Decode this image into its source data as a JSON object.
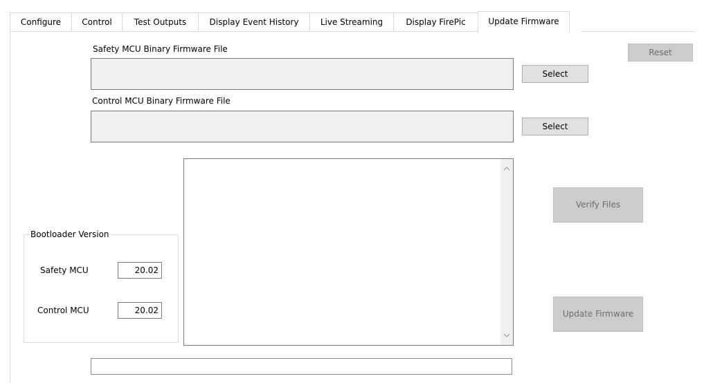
{
  "tabs": [
    {
      "label": "Configure"
    },
    {
      "label": "Control"
    },
    {
      "label": "Test Outputs"
    },
    {
      "label": "Display Event History"
    },
    {
      "label": "Live Streaming"
    },
    {
      "label": "Display FirePic"
    },
    {
      "label": "Update Firmware",
      "active": true
    }
  ],
  "reset_label": "Reset",
  "safety_file": {
    "label": "Safety MCU Binary Firmware File",
    "value": "",
    "select_label": "Select"
  },
  "control_file": {
    "label": "Control MCU Binary Firmware File",
    "value": "",
    "select_label": "Select"
  },
  "log_text": "",
  "verify_label": "Verify Files",
  "update_label": "Update Firmware",
  "bootloader": {
    "title": "Bootloader Version",
    "safety_label": "Safety MCU",
    "safety_value": "20.02",
    "control_label": "Control MCU",
    "control_value": "20.02"
  },
  "progress": 0,
  "colors": {
    "disabled_button": "#cccccc",
    "file_box": "#f0f0f0",
    "tab_border": "#d9d9d9"
  },
  "icons": {
    "scroll_up": "chevron-up-icon",
    "scroll_down": "chevron-down-icon"
  }
}
